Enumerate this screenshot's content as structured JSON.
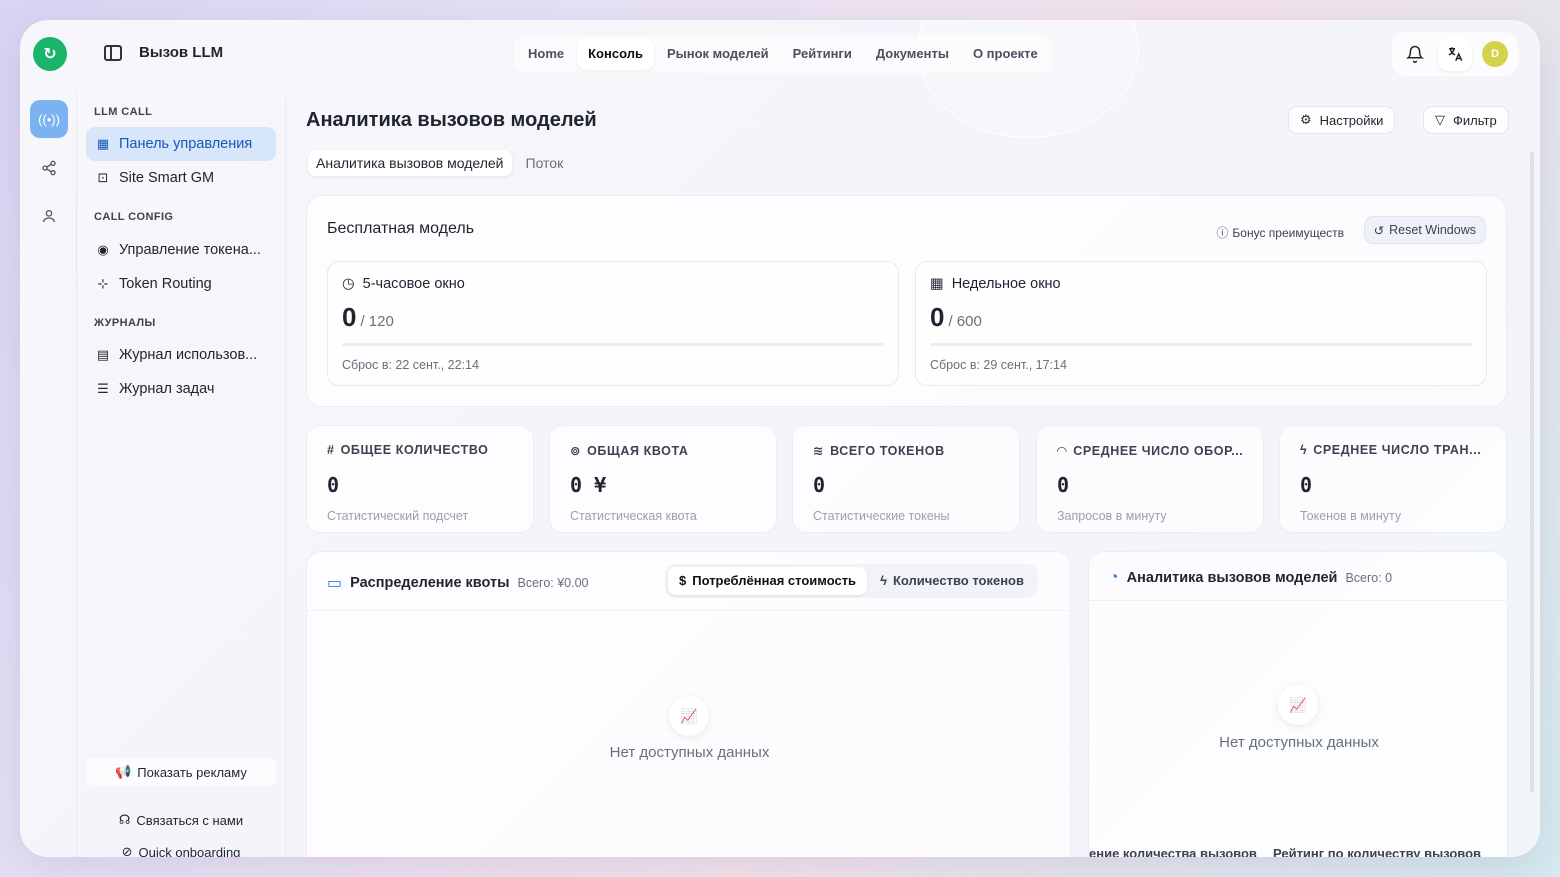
{
  "header": {
    "app_title": "Вызов LLM",
    "nav": [
      "Home",
      "Консоль",
      "Рынок моделей",
      "Рейтинги",
      "Документы",
      "О проекте"
    ],
    "nav_active": "Консоль",
    "avatar_letter": "D",
    "icons": [
      "bell-icon",
      "translate-icon"
    ]
  },
  "sidebar": {
    "group_llm": "LLM CALL",
    "item_dashboard": "Панель управления",
    "item_site": "Site Smart GM",
    "group_config": "CALL CONFIG",
    "item_tokens": "Управление токена...",
    "item_routing": "Token Routing",
    "group_logs": "ЖУРНАЛЫ",
    "item_usage_log": "Журнал использов...",
    "item_task_log": "Журнал задач",
    "ad_button": "Показать рекламу",
    "contact": "Связаться с нами",
    "onboarding": "Quick onboarding"
  },
  "main": {
    "title": "Аналитика вызовов моделей",
    "settings_btn": "Настройки",
    "filter_btn": "Фильтр",
    "tabs": [
      "Аналитика вызовов моделей",
      "Поток"
    ],
    "free": {
      "title": "Бесплатная модель",
      "bonus": "Бонус преимуществ",
      "reset": "Reset Windows",
      "windows": [
        {
          "title": "5-часовое окно",
          "value": "0",
          "limit": "/ 120",
          "reset": "Сброс в: 22 сент., 22:14"
        },
        {
          "title": "Недельное окно",
          "value": "0",
          "limit": "/ 600",
          "reset": "Сброс в: 29 сент., 17:14"
        }
      ]
    },
    "stats": [
      {
        "label": "ОБЩЕЕ КОЛИЧЕСТВО",
        "value": "0",
        "sub": "Статистический подсчет"
      },
      {
        "label": "ОБЩАЯ КВОТА",
        "value": "0 ¥",
        "sub": "Статистическая квота"
      },
      {
        "label": "ВСЕГО ТОКЕНОВ",
        "value": "0",
        "sub": "Статистические токены"
      },
      {
        "label": "СРЕДНЕЕ ЧИСЛО ОБОР...",
        "value": "0",
        "sub": "Запросов в минуту"
      },
      {
        "label": "СРЕДНЕЕ ЧИСЛО ТРАН...",
        "value": "0",
        "sub": "Токенов в минуту"
      }
    ],
    "quota_panel": {
      "title": "Распределение квоты",
      "total": "Всего: ¥0.00",
      "seg_cost": "Потреблённая стоимость",
      "seg_tokens": "Количество токенов",
      "empty": "Нет доступных данных"
    },
    "calls_panel": {
      "title": "Аналитика вызовов моделей",
      "total": "Всего: 0",
      "empty": "Нет доступных данных",
      "bottom_left": "ение количества вызовов",
      "bottom_right": "Рейтинг по количеству вызовов"
    }
  }
}
